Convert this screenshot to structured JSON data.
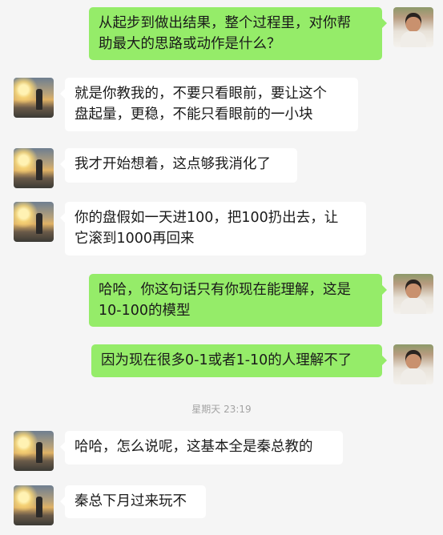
{
  "messages": [
    {
      "sender": "self",
      "lines": [
        "从起步到做出结果，整个过程里，对你帮",
        "助最大的思路或动作是什么？"
      ]
    },
    {
      "sender": "other",
      "lines": [
        "就是你教我的，不要只看眼前，要让这个",
        "盘起量，更稳，不能只看眼前的一小块"
      ]
    },
    {
      "sender": "other",
      "lines": [
        "我才开始想着，这点够我消化了"
      ]
    },
    {
      "sender": "other",
      "lines": [
        "你的盘假如一天进100，把100扔出去，让",
        "它滚到1000再回来"
      ]
    },
    {
      "sender": "self",
      "lines": [
        "哈哈，你这句话只有你现在能理解，这是",
        "10-100的模型"
      ]
    },
    {
      "sender": "self",
      "lines": [
        "因为现在很多0-1或者1-10的人理解不了"
      ]
    },
    {
      "sender": "other",
      "lines": [
        "哈哈，怎么说呢，这基本全是秦总教的"
      ]
    },
    {
      "sender": "other",
      "lines": [
        "秦总下月过来玩不"
      ]
    }
  ],
  "timestamp": "星期天 23:19",
  "colors": {
    "self_bubble": "#95ec69",
    "other_bubble": "#ffffff",
    "background": "#f5f5f5"
  }
}
